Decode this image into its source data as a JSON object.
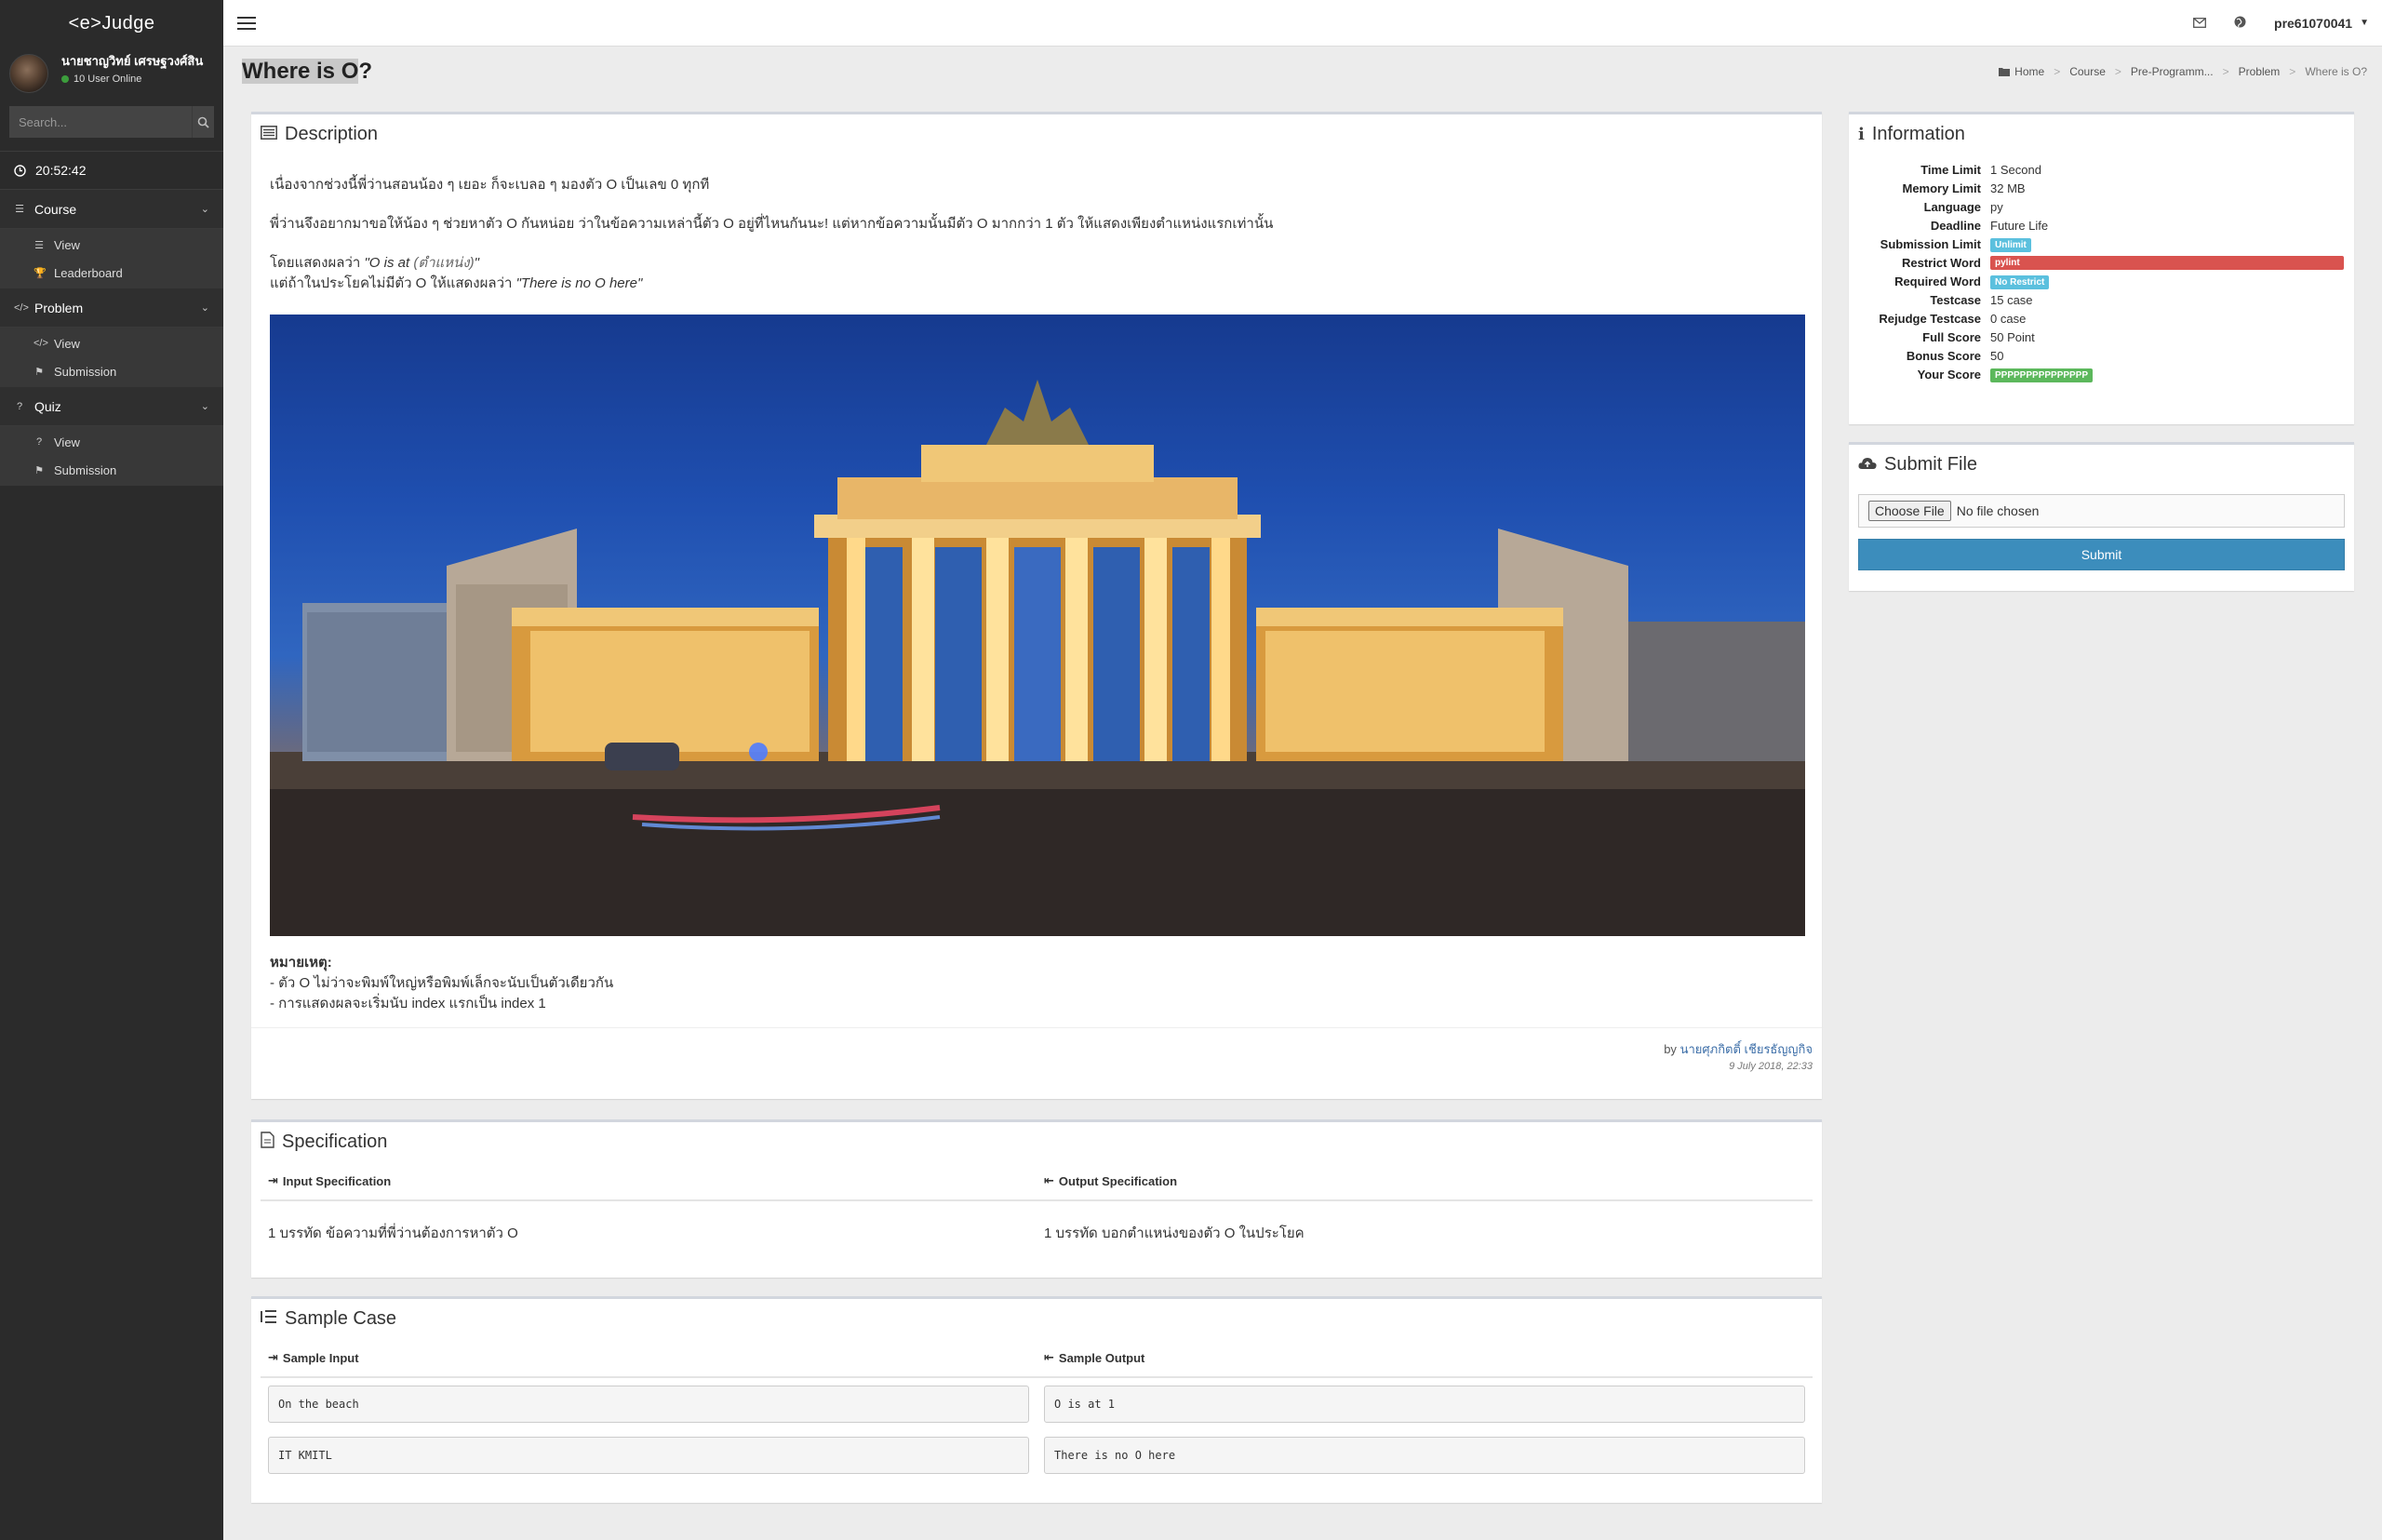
{
  "sidebar": {
    "brand": "<e>Judge",
    "user_name": "นายชาญวิทย์ เศรษฐวงศ์สิน",
    "online": "10 User Online",
    "search_placeholder": "Search...",
    "clock": "20:52:42",
    "menus": [
      {
        "label": "Course",
        "items": [
          "View",
          "Leaderboard"
        ]
      },
      {
        "label": "Problem",
        "items": [
          "View",
          "Submission"
        ]
      },
      {
        "label": "Quiz",
        "items": [
          "View",
          "Submission"
        ]
      }
    ]
  },
  "topbar": {
    "username": "pre61070041"
  },
  "page": {
    "title_highlight": "Where is O",
    "title_rest": "?"
  },
  "breadcrumb": [
    "Home",
    "Course",
    "Pre-Programm...",
    "Problem",
    "Where is O?"
  ],
  "description": {
    "title": "Description",
    "p1": "เนื่องจากช่วงนี้พี่ว่านสอนน้อง ๆ เยอะ ก็จะเบลอ ๆ มองตัว O เป็นเลข 0 ทุกที",
    "p2": "พี่ว่านจึงอยากมาขอให้น้อง ๆ ช่วยหาตัว O กันหน่อย ว่าในข้อความเหล่านี้ตัว O อยู่ที่ไหนกันนะ! แต่หากข้อความนั้นมีตัว O มากกว่า 1 ตัว ให้แสดงเพียงตำแหน่งแรกเท่านั้น",
    "p3a_prefix": "โดยแสดงผลว่า ",
    "p3a_quote_start": "\"O is at ",
    "p3a_paren": "(ตำแหน่ง)",
    "p3a_quote_end": "\"",
    "p3b_prefix": "แต่ถ้าในประโยคไม่มีตัว O ให้แสดงผลว่า ",
    "p3b_quote": "\"There is no O here\"",
    "note_title": "หมายเหตุ:",
    "note1": "- ตัว O ไม่ว่าจะพิมพ์ใหญ่หรือพิมพ์เล็กจะนับเป็นตัวเดียวกัน",
    "note2": "- การแสดงผลจะเริ่มนับ index แรกเป็น index 1",
    "by": "by",
    "author": "นายศุภกิตติ์ เชียรธัญญกิจ",
    "date": "9 July 2018, 22:33"
  },
  "specification": {
    "title": "Specification",
    "input_head": "Input Specification",
    "output_head": "Output Specification",
    "input_text": "1 บรรทัด ข้อความที่พี่ว่านต้องการหาตัว O",
    "output_text": "1 บรรทัด บอกตำแหน่งของตัว O ในประโยค"
  },
  "samples": {
    "title": "Sample Case",
    "input_head": "Sample Input",
    "output_head": "Sample Output",
    "rows": [
      {
        "input": "On the beach",
        "output": "O is at 1"
      },
      {
        "input": "IT KMITL",
        "output": "There is no O here"
      }
    ]
  },
  "information": {
    "title": "Information",
    "rows": [
      {
        "key": "Time Limit",
        "value": "1 Second"
      },
      {
        "key": "Memory Limit",
        "value": "32 MB"
      },
      {
        "key": "Language",
        "value": "py"
      },
      {
        "key": "Deadline",
        "value": "Future Life"
      },
      {
        "key": "Submission Limit",
        "badge": "Unlimit"
      },
      {
        "key": "Restrict Word",
        "badge": "pylint"
      },
      {
        "key": "Required Word",
        "badge": "No Restrict"
      },
      {
        "key": "Testcase",
        "value": "15 case"
      },
      {
        "key": "Rejudge Testcase",
        "value": "0 case"
      },
      {
        "key": "Full Score",
        "value": "50 Point"
      },
      {
        "key": "Bonus Score",
        "value": "50"
      },
      {
        "key": "Your Score",
        "badge": "PPPPPPPPPPPPPPP"
      }
    ]
  },
  "submit": {
    "title": "Submit File",
    "choose": "Choose File",
    "no_file": "No file chosen",
    "button": "Submit"
  },
  "colors": {
    "sidebar_bg": "#2b2b2b",
    "primary": "#3c8dbc",
    "info_badge": "#5bc0de",
    "danger_badge": "#d9534f",
    "success_badge": "#5cb85c"
  }
}
